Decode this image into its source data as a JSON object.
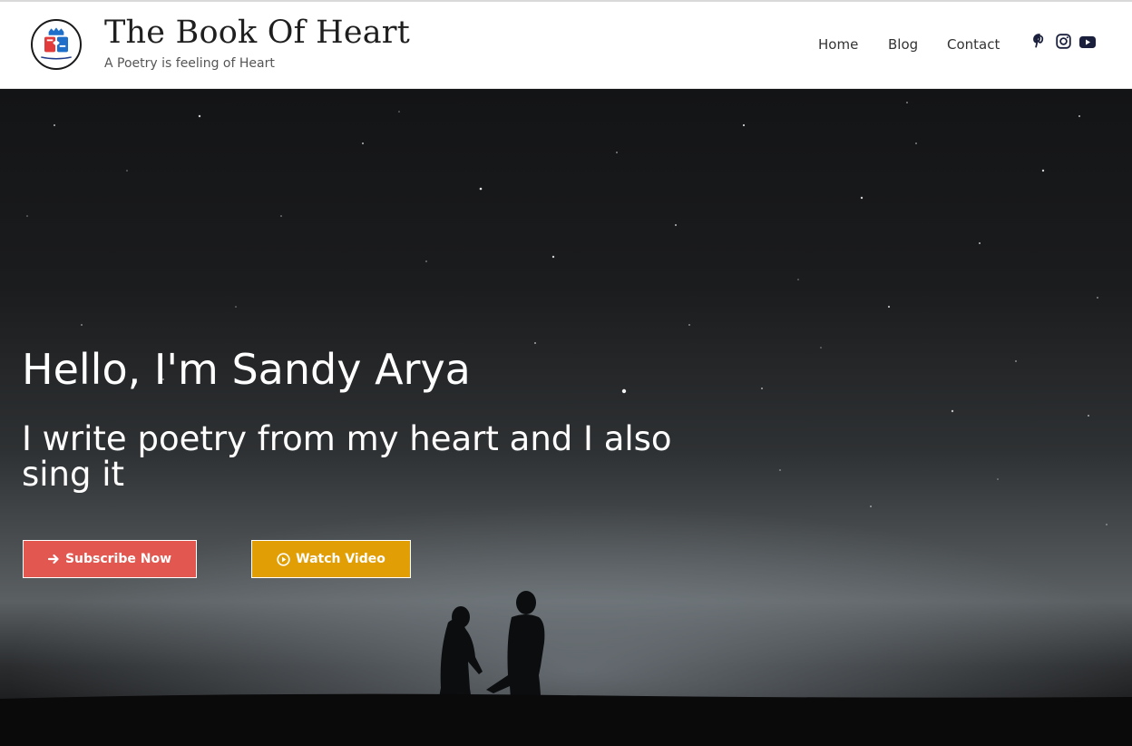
{
  "header": {
    "title": "The Book Of Heart",
    "tagline": "A Poetry is feeling of Heart",
    "logo_text": "The book of heart"
  },
  "nav": {
    "items": [
      {
        "label": "Home"
      },
      {
        "label": "Blog"
      },
      {
        "label": "Contact"
      }
    ]
  },
  "social": {
    "icons": [
      "pinterest-icon",
      "instagram-icon",
      "youtube-icon"
    ]
  },
  "hero": {
    "heading": "Hello, I'm Sandy Arya",
    "subheading": "I write poetry from my heart and I also sing it",
    "buttons": {
      "subscribe": {
        "label": "Subscribe Now",
        "icon": "arrow-right-icon",
        "color": "#e2574f"
      },
      "watch": {
        "label": "Watch Video",
        "icon": "play-circle-icon",
        "color": "#e19e05"
      }
    }
  }
}
